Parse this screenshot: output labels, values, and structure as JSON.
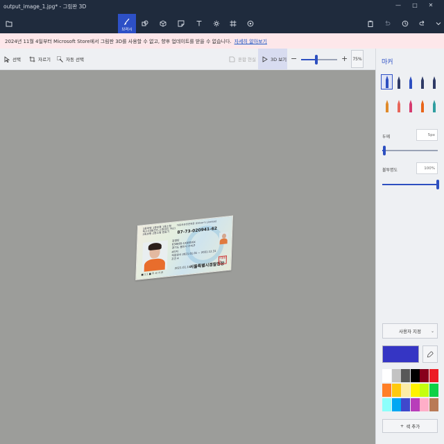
{
  "window": {
    "title": "output_image_1.jpg* - 그림판 3D",
    "controls": [
      "—",
      "□",
      "✕"
    ]
  },
  "ribbon": {
    "active_tab_label": "브러시",
    "tools": [
      {
        "name": "menu",
        "icon": "folder-icon"
      },
      {
        "name": "brushes",
        "icon": "brush-icon",
        "label": "브러시"
      },
      {
        "name": "2d-shapes",
        "icon": "2d-shapes-icon"
      },
      {
        "name": "3d-shapes",
        "icon": "3d-shapes-icon"
      },
      {
        "name": "stickers",
        "icon": "sticker-icon"
      },
      {
        "name": "text",
        "icon": "text-icon"
      },
      {
        "name": "effects",
        "icon": "effects-icon"
      },
      {
        "name": "canvas",
        "icon": "canvas-icon"
      },
      {
        "name": "3d-library",
        "icon": "3d-library-icon"
      }
    ],
    "right": [
      "paste-icon",
      "undo-icon",
      "history-icon",
      "redo-icon",
      "expand-icon"
    ]
  },
  "notice": {
    "text": "2024년 11월 4일부터 Microsoft Store에서 그림판 3D를 사용할 수 없고, 향후 업데이트를 받을 수 없습니다.",
    "link": "자세히 알아보기"
  },
  "toolbar": {
    "select": "선택",
    "crop": "자르기",
    "magic_select": "자동 선택",
    "mixed_reality": "혼합 현실",
    "view3d": "3D 보기",
    "zoom_minus": "−",
    "zoom_plus": "+",
    "zoom_value": "75%",
    "zoom_level": 0.42
  },
  "card": {
    "header_left": "1종대형 1종보통 1종소형\n특수(대형견인,소형견인,구난)\n2종보통 2종소형 원동기",
    "header_right": "자동차운전면허증 (Driver's License)",
    "license_no": "87-73-020941-62",
    "name": "김영민",
    "rrn": "830805-1XXXXXX",
    "address": "경기도 용인시 수지구",
    "address2": "4단지",
    "period_label": "적성검사",
    "period": "2021.01.01 ~ 2031.12.31",
    "condition": "조건 4",
    "issued": "2021.01.18",
    "issuer": "서울특별시경찰청장",
    "seal": "서울청장",
    "footer": "■ 1:1 ■ 주 씨 가 온"
  },
  "panel": {
    "title": "마커",
    "thickness_label": "두께",
    "thickness_value": "5px",
    "thickness_level": 0.04,
    "opacity_label": "불투명도",
    "opacity_value": "100%",
    "opacity_level": 1.0,
    "custom_label": "사용자 지정",
    "add_color_label": "색 추가",
    "current_color": "#3535c4",
    "brushes": [
      {
        "name": "marker",
        "icon": "marker-icon",
        "color": "#2d4fc0"
      },
      {
        "name": "calligraphy-pen",
        "icon": "calligraphy-pen-icon",
        "color": "#2e3a66"
      },
      {
        "name": "oil-brush",
        "icon": "oil-brush-icon",
        "color": "#2d4fc0"
      },
      {
        "name": "watercolor",
        "icon": "watercolor-icon",
        "color": "#2e3a66"
      },
      {
        "name": "pixel-pen",
        "icon": "pixel-pen-icon",
        "color": "#2e3a66"
      },
      {
        "name": "pencil",
        "icon": "pencil-icon",
        "color": "#e08a2a"
      },
      {
        "name": "eraser",
        "icon": "eraser-icon",
        "color": "#e8665a"
      },
      {
        "name": "crayon",
        "icon": "crayon-icon",
        "color": "#d63b6f"
      },
      {
        "name": "spray-can",
        "icon": "spray-can-icon",
        "color": "#e8651a"
      },
      {
        "name": "fill",
        "icon": "fill-icon",
        "color": "#2f9ea0"
      }
    ],
    "palette": [
      "#ffffff",
      "#c3c3c3",
      "#585858",
      "#000000",
      "#88001b",
      "#ec1c24",
      "#ff7f27",
      "#ffc90e",
      "#fdeca6",
      "#fff200",
      "#c4ff0e",
      "#0ed145",
      "#8cfffb",
      "#00a8f3",
      "#3f48cc",
      "#b83dba",
      "#ffaec8",
      "#b97a56"
    ]
  }
}
